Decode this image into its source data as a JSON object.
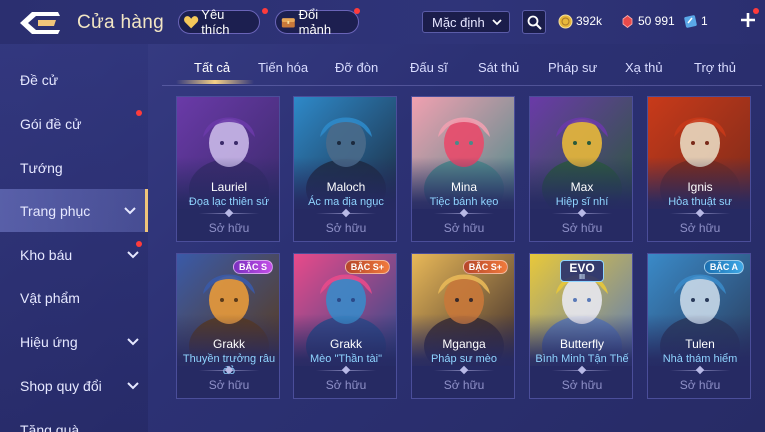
{
  "header": {
    "title": "Cửa hàng",
    "favorite_label": "Yêu thích",
    "exchange_label": "Đổi mảnh",
    "sort_value": "Mặc định",
    "gold": "392k",
    "gems": "50 991",
    "vouchers": "1"
  },
  "sidebar": {
    "items": [
      {
        "label": "Đề cử"
      },
      {
        "label": "Gói đề cử"
      },
      {
        "label": "Tướng"
      },
      {
        "label": "Trang phục"
      },
      {
        "label": "Kho báu"
      },
      {
        "label": "Vật phẩm"
      },
      {
        "label": "Hiệu ứng"
      },
      {
        "label": "Shop quy đổi"
      },
      {
        "label": "Tặng quà"
      }
    ],
    "active": "Trang phục"
  },
  "tabs": {
    "items": [
      {
        "label": "Tất cả"
      },
      {
        "label": "Tiến hóa"
      },
      {
        "label": "Đỡ đòn"
      },
      {
        "label": "Đấu sĩ"
      },
      {
        "label": "Sát thủ"
      },
      {
        "label": "Pháp sư"
      },
      {
        "label": "Xạ thủ"
      },
      {
        "label": "Trợ thủ"
      }
    ],
    "active": "Tất cả"
  },
  "skins": [
    {
      "hero": "Lauriel",
      "skin": "Đọa lạc thiên sứ",
      "status": "Sở hữu",
      "palette": [
        "#3a2a6a",
        "#c9b8e8",
        "#6a3aa8"
      ]
    },
    {
      "hero": "Maloch",
      "skin": "Ác ma địa ngục",
      "status": "Sở hữu",
      "palette": [
        "#1c2a3e",
        "#4a6a8a",
        "#2e89c9"
      ]
    },
    {
      "hero": "Mina",
      "skin": "Tiệc bánh kẹo",
      "status": "Sở hữu",
      "palette": [
        "#4a8a8a",
        "#e84a6a",
        "#f0a0b0"
      ]
    },
    {
      "hero": "Max",
      "skin": "Hiệp sĩ nhí",
      "status": "Sở hữu",
      "palette": [
        "#2a5a3a",
        "#e8b83a",
        "#6a3aa8"
      ]
    },
    {
      "hero": "Ignis",
      "skin": "Hỏa thuật sư",
      "status": "Sở hữu",
      "palette": [
        "#7a2a1a",
        "#e8d8c0",
        "#c83a1a"
      ]
    },
    {
      "hero": "Grakk",
      "skin": "Thuyền trưởng râu đỏ",
      "status": "Sở hữu",
      "tier": "BẬC S",
      "tier_style": "s",
      "palette": [
        "#5a3a1a",
        "#e89a3a",
        "#3a5aa8"
      ]
    },
    {
      "hero": "Grakk",
      "skin": "Mèo \"Thần tài\"",
      "status": "Sở hữu",
      "tier": "BẬC S+",
      "tier_style": "sp",
      "palette": [
        "#2a4a8a",
        "#3a8ac8",
        "#e84a8a"
      ]
    },
    {
      "hero": "Mganga",
      "skin": "Pháp sư mèo",
      "status": "Sở hữu",
      "tier": "BẬC S+",
      "tier_style": "sp",
      "palette": [
        "#3a2a2a",
        "#c8783a",
        "#e8b858"
      ]
    },
    {
      "hero": "Butterfly",
      "skin": "Bình Minh Tận Thế",
      "status": "Sở hữu",
      "tier": "EVO",
      "tier_level": "III",
      "tier_style": "evo",
      "palette": [
        "#5a7ab8",
        "#e8e8f0",
        "#e8c83a"
      ]
    },
    {
      "hero": "Tulen",
      "skin": "Nhà thám hiểm",
      "status": "Sở hữu",
      "tier": "BẬC A",
      "tier_style": "a",
      "palette": [
        "#2a3a5a",
        "#c8d8e8",
        "#3a8ac8"
      ]
    }
  ],
  "colors": {
    "accent_gold": "#f5d186",
    "skin_name": "#8fd4ff",
    "notification": "#ff3b3b"
  }
}
